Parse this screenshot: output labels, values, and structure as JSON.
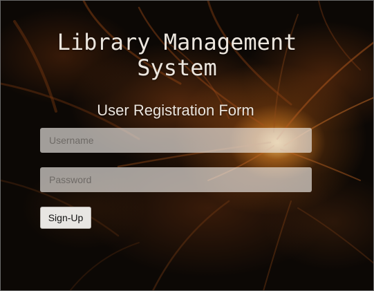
{
  "header": {
    "title_line1": "Library Management",
    "title_line2": "System",
    "subtitle": "User Registration Form"
  },
  "form": {
    "username_placeholder": "Username",
    "username_value": "",
    "password_placeholder": "Password",
    "password_value": "",
    "signup_label": "Sign-Up"
  },
  "colors": {
    "title_text": "#ece6de",
    "input_background": "rgba(235,230,225,0.68)",
    "button_background": "#e8e6e3",
    "background_glow": "#c8641a"
  }
}
